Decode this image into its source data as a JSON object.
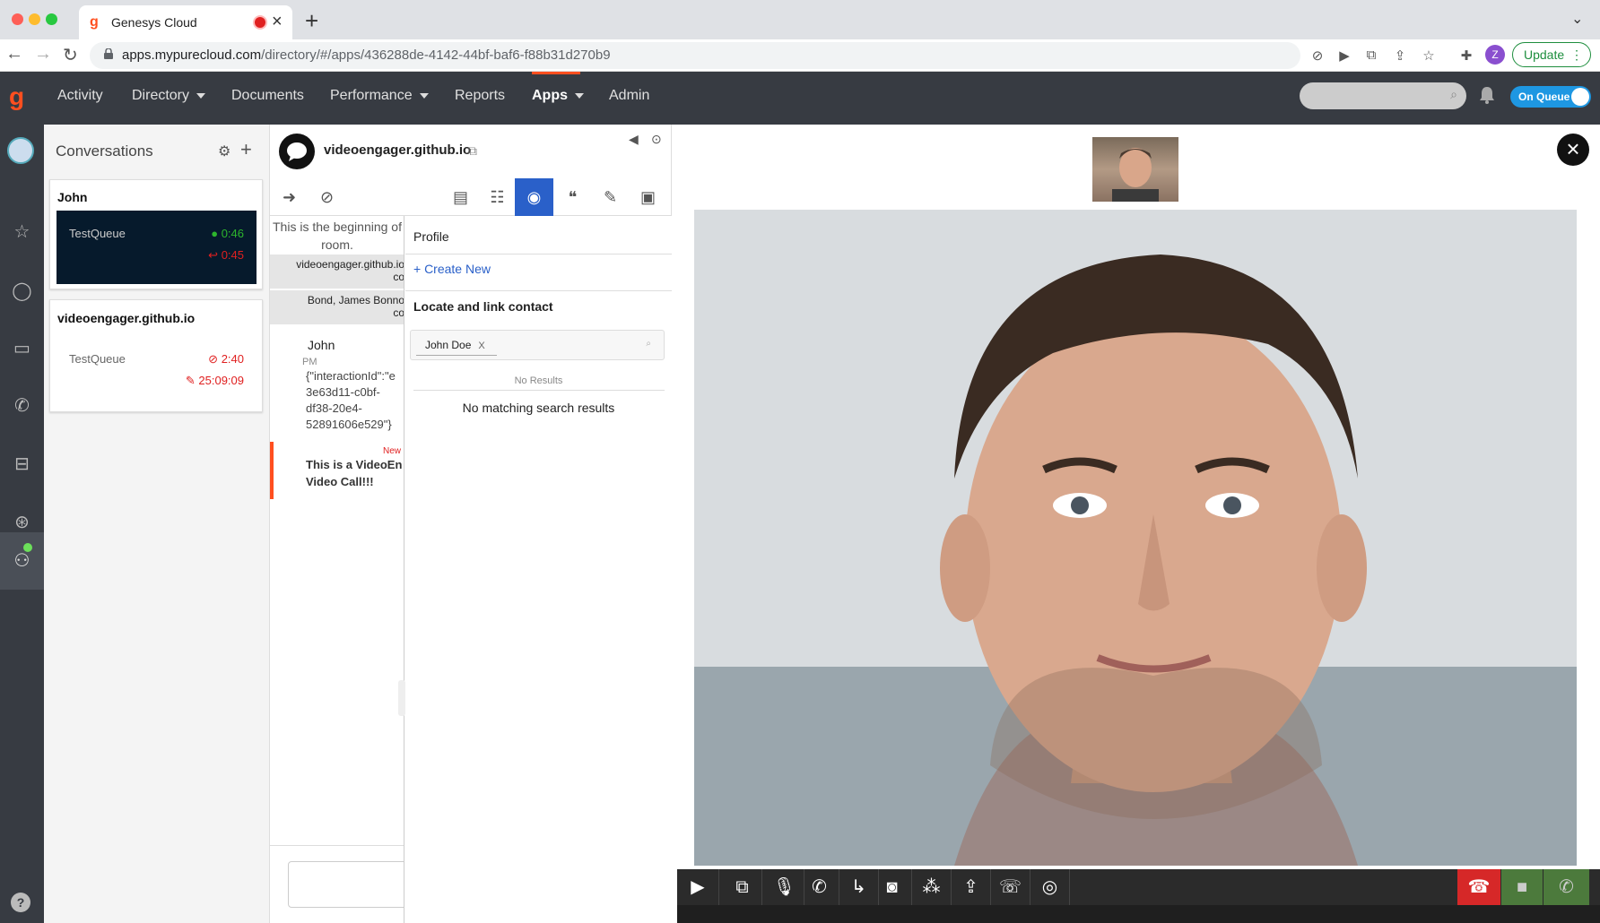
{
  "browser": {
    "tab_title": "Genesys Cloud",
    "url_host": "apps.mypurecloud.com",
    "url_path": "/directory/#/apps/436288de-4142-44bf-baf6-f88b31d270b9",
    "update_label": "Update",
    "profile_initial": "Z"
  },
  "nav": {
    "items": [
      "Activity",
      "Directory",
      "Documents",
      "Performance",
      "Reports",
      "Apps",
      "Admin"
    ],
    "active": "Apps",
    "status_toggle": "On Queue"
  },
  "conversations": {
    "title": "Conversations",
    "cards": [
      {
        "name": "John",
        "queue": "TestQueue",
        "chat_time": "0:46",
        "reply_time": "0:45"
      },
      {
        "name": "videoengager.github.io",
        "queue": "TestQueue",
        "video_time": "2:40",
        "edit_time": "25:09:09"
      }
    ]
  },
  "interaction": {
    "name": "videoengager.github.io",
    "transcript": {
      "begin_line1": "This is the beginning of",
      "begin_line2": "room.",
      "sys1_line1": "videoengager.github.io",
      "sys1_line2": "co",
      "sys2_line1": "Bond, James Bonno",
      "sys2_line2": "co",
      "msg_author": "John",
      "msg_time": "PM",
      "msg_lines": [
        "{\"interactionId\":\"e",
        "3e63d11-c0bf-",
        "df38-20e4-",
        "52891606e529\"}"
      ],
      "new_badge": "New",
      "new_lines": [
        "This is a VideoEn",
        "Video Call!!!"
      ]
    },
    "profile": {
      "title": "Profile",
      "create_new": "+ Create New",
      "locate_title": "Locate and link contact",
      "chip": "John Doe",
      "chip_remove": "X",
      "no_results": "No Results",
      "no_match": "No matching search results"
    }
  },
  "colors": {
    "brand": "#ff4f1f",
    "header_bg": "#373b42",
    "accent_blue": "#2a60c9",
    "hangup_red": "#d62828",
    "green": "#4c7a3c",
    "timer_green": "#2db52d",
    "timer_red": "#e02020"
  },
  "icons": [
    "transfer-icon",
    "mute-icon",
    "script-icon",
    "contact-icon",
    "profile-icon",
    "quote-icon",
    "notes-icon",
    "wrapup-icon",
    "camera-icon",
    "screenshare-icon",
    "mic-icon",
    "hold-icon",
    "callback-icon",
    "snapshot-icon",
    "blur-icon",
    "file-icon",
    "dial-icon",
    "switch-camera-icon",
    "hangup-icon"
  ]
}
